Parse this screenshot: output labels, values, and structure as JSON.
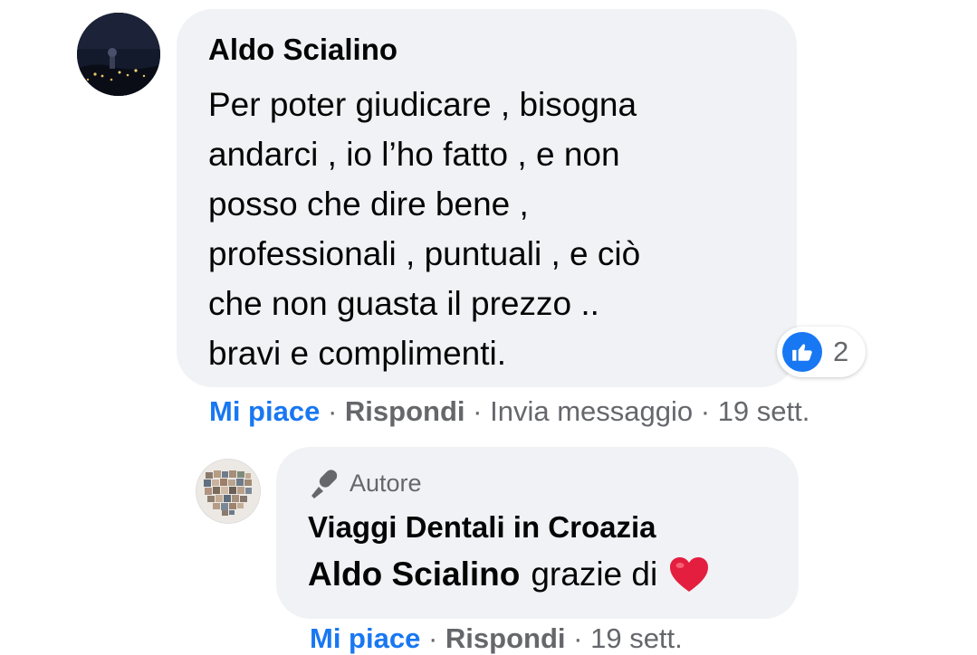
{
  "comment": {
    "author": "Aldo Scialino",
    "text": "Per poter giudicare , bisogna\nandarci , io l’ho fatto , e non\nposso che dire bene ,\nprofessionali , puntuali , e ciò\nche non guasta il prezzo ..\nbravi e complimenti.",
    "reactions": {
      "icon": "like-icon",
      "count": "2"
    },
    "actions": {
      "like": "Mi piace",
      "reply": "Rispondi",
      "message": "Invia messaggio",
      "time": "19 sett.",
      "separator": "·"
    }
  },
  "reply": {
    "badge": {
      "icon": "microphone-icon",
      "label": "Autore"
    },
    "author": "Viaggi Dentali in Croazia",
    "mention": "Aldo Scialino",
    "text": "grazie di",
    "emoji": "heart-icon"
  },
  "colors": {
    "link_blue": "#1877f2",
    "bubble_bg": "#f0f2f5",
    "secondary_text": "#65676b",
    "primary_text": "#050505",
    "heart_red": "#e41e3f"
  }
}
